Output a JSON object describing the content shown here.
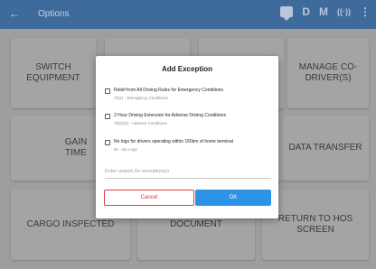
{
  "header": {
    "back_label": "←",
    "title": "Options",
    "icons": [
      "chat-icon",
      "D",
      "M",
      "signal-icon",
      "more-icon"
    ],
    "d_label": "D",
    "m_label": "M",
    "signal_label": "((·))",
    "more_label": "⋮"
  },
  "tiles": [
    {
      "label": "SWITCH EQUIPMENT"
    },
    {
      "label": ""
    },
    {
      "label": ""
    },
    {
      "label": "MANAGE CO-DRIVER(S)"
    },
    {
      "label": "GAIN TIME"
    },
    {
      "label": ""
    },
    {
      "label": ""
    },
    {
      "label": "DATA TRANSFER"
    },
    {
      "label": "CARGO INSPECTED"
    },
    {
      "label": "DOCUMENT"
    },
    {
      "label": "RETURN TO HOS SCREEN"
    }
  ],
  "dialog": {
    "title": "Add Exception",
    "options": [
      {
        "label": "Relief from All Driving Rules for Emergency Conditions",
        "sub": "70(1) - Emergency Conditions"
      },
      {
        "label": "2 Hour Driving Extension for Adverse Driving Conditions",
        "sub": "76(2)(3) - Adverse Conditions"
      },
      {
        "label": "No logs for drivers operating within 160km of home terminal",
        "sub": "81 - No Logs"
      }
    ],
    "reason_placeholder": "Enter reason for exception(s)",
    "cancel_label": "Cancel",
    "ok_label": "OK"
  },
  "colors": {
    "topbar": "#3f6a9c",
    "ok_button": "#2c93e8",
    "cancel_border": "#dd4444"
  }
}
